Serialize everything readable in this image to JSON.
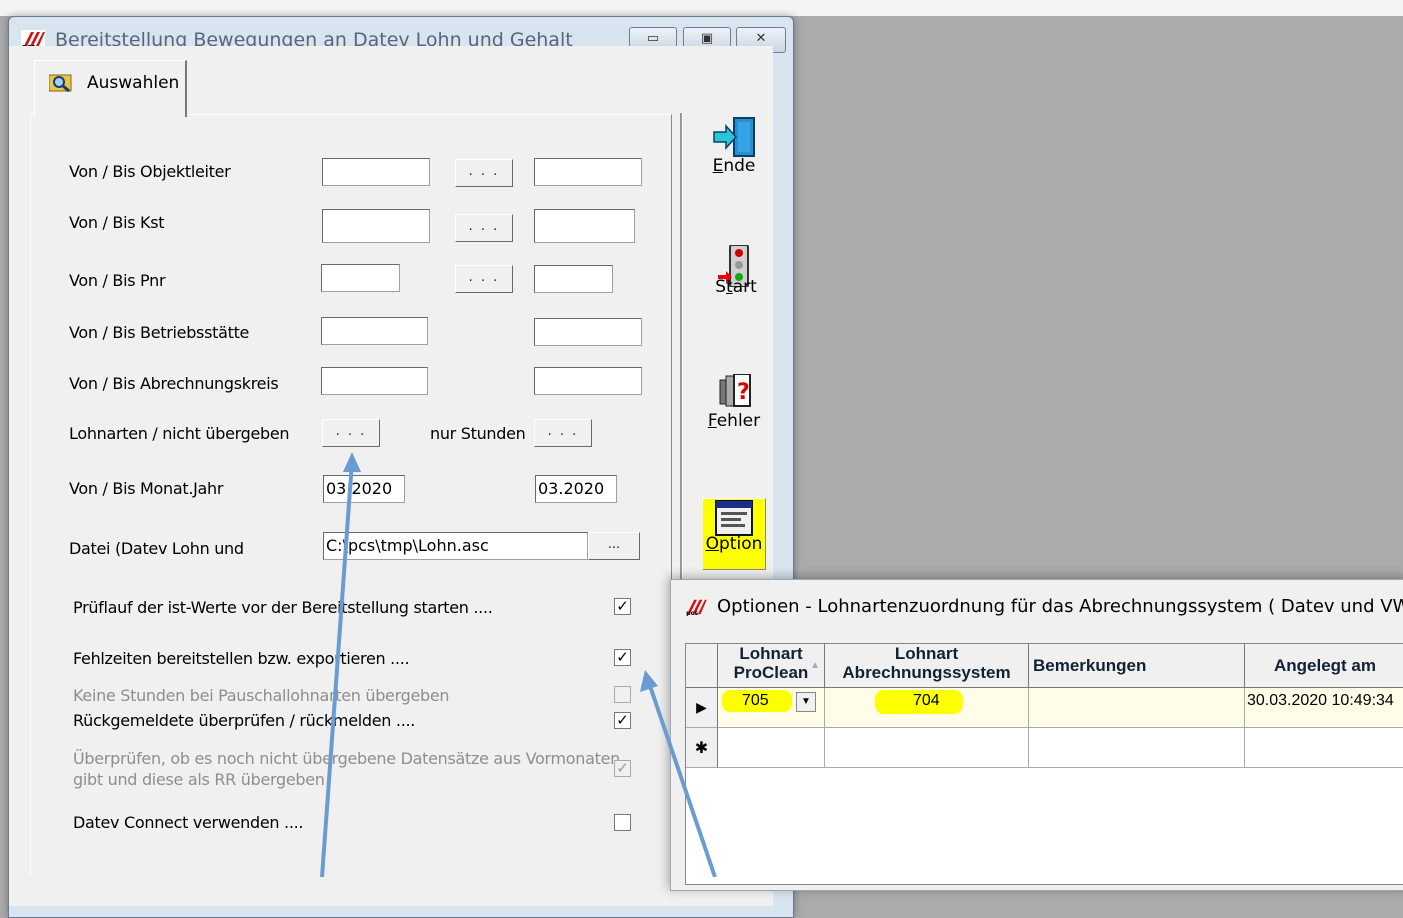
{
  "main_window": {
    "title": "Bereitstellung Bewegungen an Datev Lohn und Gehalt",
    "tab_label": "Auswahlen",
    "window_buttons": {
      "minimize": "▭",
      "restore": "▣",
      "close": "✕"
    }
  },
  "form": {
    "objektleiter_label": "Von / Bis Objektleiter",
    "kst_label": "Von / Bis Kst",
    "pnr_label": "Von / Bis Pnr",
    "betriebsstaette_label": "Von / Bis Betriebsstätte",
    "abrechnungskreis_label": "Von / Bis Abrechnungskreis",
    "lohnarten_label": "Lohnarten / nicht übergeben",
    "nur_stunden_label": "nur Stunden",
    "monat_jahr_label": "Von / Bis Monat.Jahr",
    "monat_von": "03.2020",
    "monat_bis": "03.2020",
    "datei_label": "Datei (Datev Lohn und",
    "datei_value": "C:\\pcs\\tmp\\Lohn.asc",
    "ellipsis": ". . .",
    "file_ellipsis": "..."
  },
  "checkboxes": {
    "prueflauf": {
      "label": "Prüflauf der ist-Werte vor der Bereitstellung starten ....",
      "checked": true,
      "mark": "✓"
    },
    "fehlzeiten": {
      "label": "Fehlzeiten bereitstellen bzw. exportieren ....",
      "checked": true,
      "mark": "✓"
    },
    "keine_stunden": {
      "label": "Keine Stunden bei Pauschallohnarten übergeben",
      "checked": false,
      "mark": ""
    },
    "rueckgemeldete": {
      "label": "Rückgemeldete überprüfen / rückmelden ....",
      "checked": true,
      "mark": "✓"
    },
    "ueberpruefen_line1": "Überprüfen, ob es noch nicht übergebene Datensätze aus Vormonaten",
    "ueberpruefen_line2": "gibt und diese als RR übergeben",
    "ueberpruefen_mark": "✓",
    "datev_connect": {
      "label": "Datev Connect verwenden ....",
      "checked": false,
      "mark": ""
    }
  },
  "toolbar": {
    "ende_underlined": "E",
    "ende_rest": "nde",
    "start_pre": "S",
    "start_underlined": "t",
    "start_rest": "art",
    "fehler_underlined": "F",
    "fehler_rest": "ehler",
    "option_underlined": "O",
    "option_rest": "ption"
  },
  "options_window": {
    "title": "Optionen - Lohnartenzuordnung für das Abrechnungssystem ( Datev und VWE )",
    "columns": {
      "lohnart_proclean_1": "Lohnart",
      "lohnart_proclean_2": "ProClean",
      "lohnart_abr_1": "Lohnart",
      "lohnart_abr_2": "Abrechnungssystem",
      "bemerkungen": "Bemerkungen",
      "angelegt_am": "Angelegt am"
    },
    "rows": [
      {
        "lohnart_proclean": "705",
        "lohnart_abrechnung": "704",
        "bemerkungen": "",
        "angelegt_am": "30.03.2020 10:49:34"
      }
    ],
    "new_row_marker": "✱",
    "current_row_marker": "▶"
  },
  "colors": {
    "highlight": "#fdff00",
    "arrow": "#6a9bd1",
    "title_text": "#5a6676"
  }
}
